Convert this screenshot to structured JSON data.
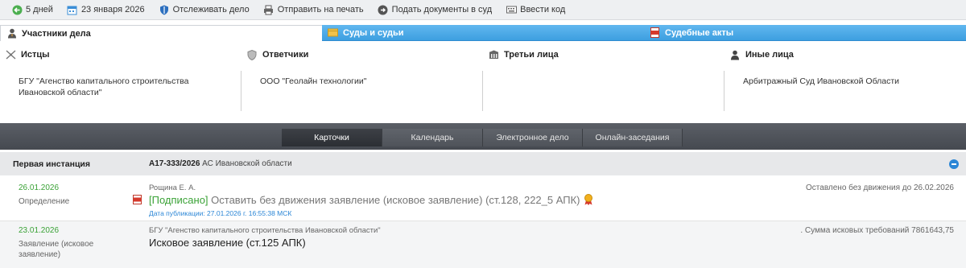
{
  "toolbar": {
    "items": [
      {
        "label": "5 дней",
        "icon": "back-arrow-icon"
      },
      {
        "label": "23 января 2026",
        "icon": "calendar-icon"
      },
      {
        "label": "Отслеживать дело",
        "icon": "shield-icon"
      },
      {
        "label": "Отправить на печать",
        "icon": "printer-icon"
      },
      {
        "label": "Подать документы в суд",
        "icon": "arrow-circle-icon"
      },
      {
        "label": "Ввести код",
        "icon": "keyboard-icon"
      }
    ]
  },
  "tabs": [
    {
      "label": "Участники дела",
      "icon": "person-icon",
      "active": true
    },
    {
      "label": "Суды и судьи",
      "icon": "folder-icon",
      "active": false
    },
    {
      "label": "Судебные акты",
      "icon": "pdf-icon",
      "active": false
    }
  ],
  "parties": [
    {
      "title": "Истцы",
      "icon": "scales-icon",
      "text": "БГУ \"Агенство капитального строительства Ивановской области\""
    },
    {
      "title": "Ответчики",
      "icon": "shield-icon",
      "text": "ООО \"Геолайн технологии\""
    },
    {
      "title": "Третьи лица",
      "icon": "building-icon",
      "text": ""
    },
    {
      "title": "Иные лица",
      "icon": "person-icon",
      "text": "Арбитражный Суд Ивановской Области"
    }
  ],
  "nav": {
    "buttons": [
      {
        "label": "Карточки",
        "active": true
      },
      {
        "label": "Календарь",
        "active": false
      },
      {
        "label": "Электронное дело",
        "active": false
      },
      {
        "label": "Онлайн-заседания",
        "active": false
      }
    ]
  },
  "instance": {
    "label": "Первая инстанция",
    "case_number": "А17-333/2026",
    "court": " АС Ивановской области"
  },
  "rows": [
    {
      "date": "26.01.2026",
      "type": "Определение",
      "author": "Рощина Е. А.",
      "signed": "[Подписано]",
      "title": " Оставить без движения заявление (исковое заявление) (ст.128, 222_5 АПК)",
      "pub": "Дата публикации: 27.01.2026 г. 16:55:38 МСК",
      "right": "Оставлено без движения до 26.02.2026"
    },
    {
      "date": "23.01.2026",
      "type": "Заявление (исковое заявление)",
      "author": "БГУ \"Агенство капитального строительства Ивановской области\"",
      "title": "Исковое заявление (ст.125 АПК)",
      "right": ". Сумма исковых требований 7861643,75"
    }
  ],
  "colors": {
    "accent_blue": "#3d9fe0",
    "date_green": "#3aa236",
    "nav_dark": "#454950"
  }
}
